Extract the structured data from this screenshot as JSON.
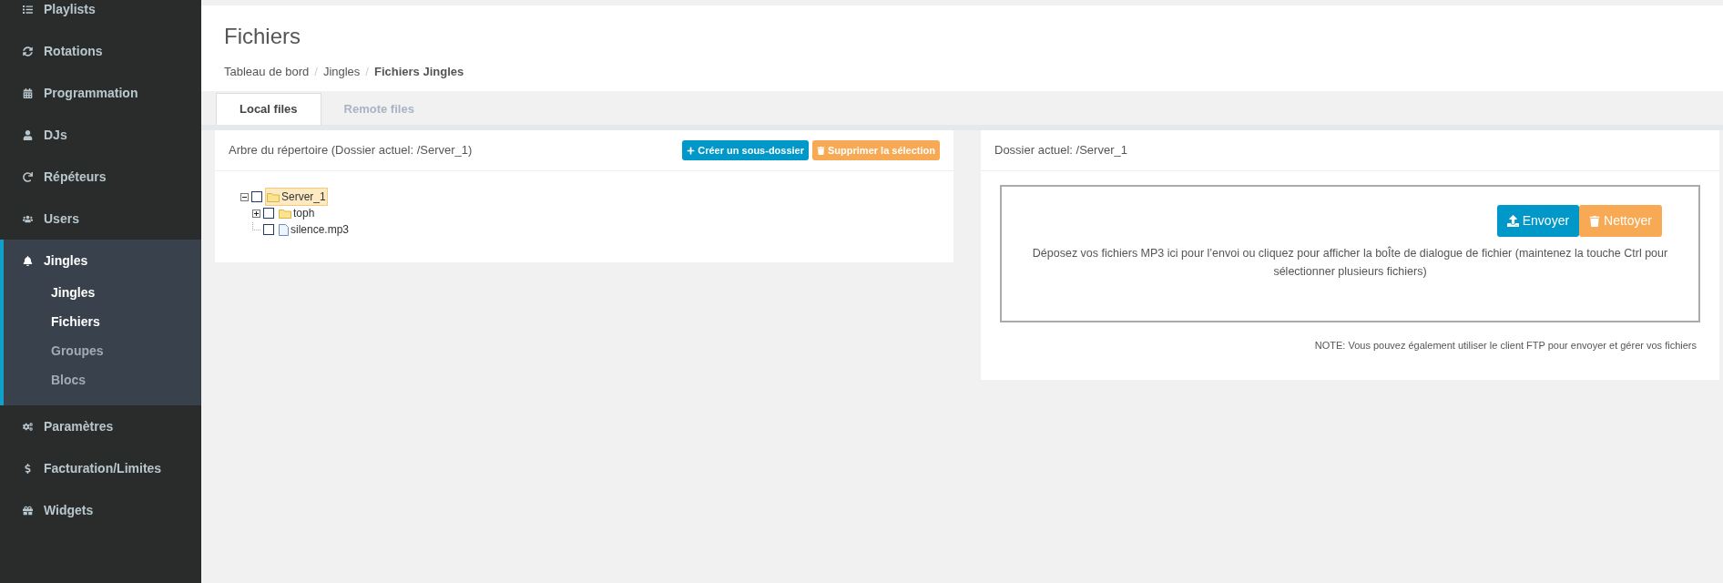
{
  "sidebar": {
    "items": [
      {
        "label": "Playlists",
        "selected": false
      },
      {
        "label": "Rotations",
        "selected": false
      },
      {
        "label": "Programmation",
        "selected": false
      },
      {
        "label": "DJs",
        "selected": false
      },
      {
        "label": "Répéteurs",
        "selected": false
      },
      {
        "label": "Users",
        "selected": false
      },
      {
        "label": "Jingles",
        "selected": true,
        "children": [
          {
            "label": "Jingles",
            "selected": true
          },
          {
            "label": "Fichiers",
            "selected": true
          },
          {
            "label": "Groupes",
            "selected": false
          },
          {
            "label": "Blocs",
            "selected": false
          }
        ]
      },
      {
        "label": "Paramètres",
        "selected": false
      },
      {
        "label": "Facturation/Limites",
        "selected": false
      },
      {
        "label": "Widgets",
        "selected": false
      }
    ]
  },
  "header": {
    "title": "Fichiers",
    "separator": "/",
    "breadcrumb": [
      {
        "label": "Tableau de bord",
        "current": false
      },
      {
        "label": "Jingles",
        "current": false
      },
      {
        "label": "Fichiers Jingles",
        "current": true
      }
    ]
  },
  "tabs": [
    {
      "label": "Local files",
      "selected": true
    },
    {
      "label": "Remote files",
      "selected": false
    }
  ],
  "tree_panel": {
    "title": "Arbre du répertoire (Dossier actuel: /Server_1)",
    "buttons": [
      {
        "label": "Créer un sous-dossier",
        "kind": "primary"
      },
      {
        "label": "Supprimer la sélection",
        "kind": "warning"
      }
    ],
    "tree": [
      {
        "label": "Server_1",
        "kind": "folder",
        "expanded": true,
        "checked": false,
        "selected": true,
        "children": [
          {
            "label": "toph",
            "kind": "folder",
            "expanded": false,
            "checked": false,
            "selected": false
          },
          {
            "label": "silence.mp3",
            "kind": "file",
            "checked": false,
            "selected": false
          }
        ]
      }
    ]
  },
  "upload_panel": {
    "title": "Dossier actuel: /Server_1",
    "buttons": [
      {
        "label": "Envoyer",
        "kind": "primary"
      },
      {
        "label": "Nettoyer",
        "kind": "warning"
      }
    ],
    "dropzone_text": "Déposez vos fichiers MP3 ici pour l’envoi ou cliquez pour afficher la boÎte de dialogue de fichier (maintenez la touche Ctrl pour sélectionner plusieurs fichiers)",
    "note": "NOTE: Vous pouvez également utiliser le client FTP pour envoyer et gérer vos fichiers"
  }
}
